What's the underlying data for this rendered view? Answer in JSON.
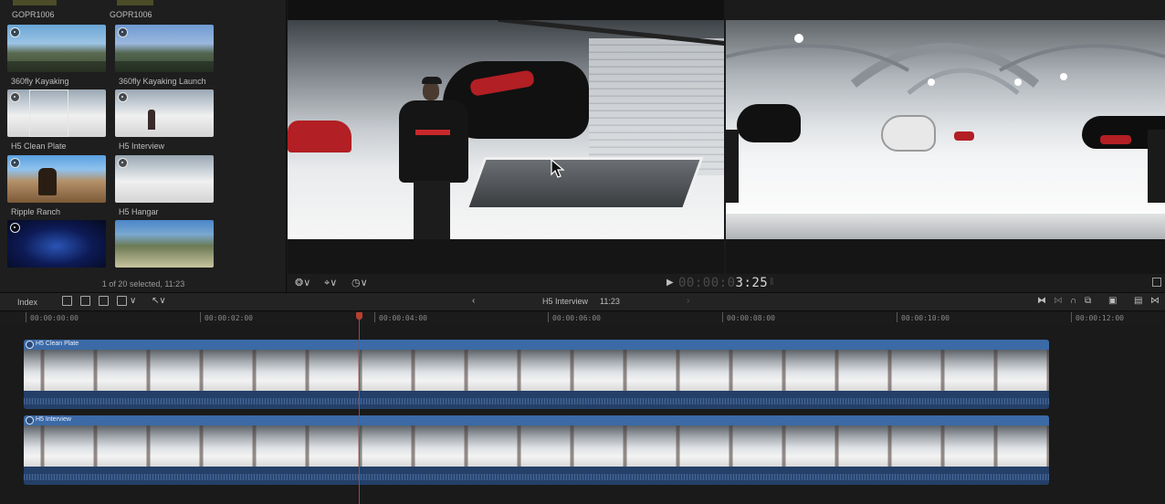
{
  "browser": {
    "top_labels": [
      "GOPR1006",
      "GOPR1006"
    ],
    "clips": [
      {
        "name": "360fly Kayaking"
      },
      {
        "name": "360fly Kayaking Launch"
      },
      {
        "name": "H5 Clean Plate"
      },
      {
        "name": "H5 Interview"
      },
      {
        "name": "Ripple Ranch"
      },
      {
        "name": "H5 Hangar"
      }
    ],
    "status": "1 of 20 selected, 11:23"
  },
  "viewer": {
    "timecode_dim": "00:00:0",
    "timecode_bright": "3:25"
  },
  "toolbar": {
    "index_label": "Index",
    "project_name": "H5 Interview",
    "project_duration": "11:23"
  },
  "ruler": {
    "labels": [
      "00:00:00:00",
      "00:00:02:00",
      "00:00:04:00",
      "00:00:06:00",
      "00:00:08:00",
      "00:00:10:00",
      "00:00:12:00"
    ]
  },
  "timeline": {
    "clips": [
      {
        "name": "H5 Clean Plate"
      },
      {
        "name": "H5 Interview"
      }
    ]
  },
  "colors": {
    "playhead": "#b64030",
    "clip_blue": "#3b6aa7"
  }
}
